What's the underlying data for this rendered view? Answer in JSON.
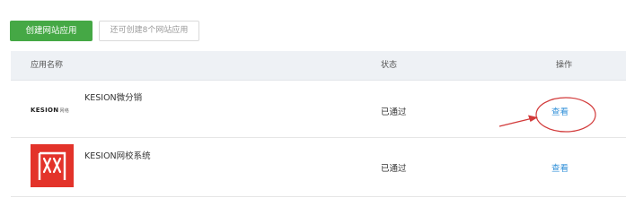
{
  "toolbar": {
    "create_label": "创建网站应用",
    "quota_text": "还可创建8个网站应用"
  },
  "table": {
    "headers": {
      "name": "应用名称",
      "status": "状态",
      "action": "操作"
    },
    "rows": [
      {
        "name": "KESION微分销",
        "status": "已通过",
        "action": "查看",
        "logo": "kesion-logo",
        "logo_text": "KESION",
        "logo_sub": "网络"
      },
      {
        "name": "KESION网校系统",
        "status": "已通过",
        "action": "查看",
        "logo": "wang-logo",
        "logo_text": "网"
      }
    ]
  },
  "colors": {
    "primary_green": "#45a845",
    "link_blue": "#2f8fd8",
    "annotation_red": "#d23a3a",
    "logo_red": "#e3332a"
  }
}
